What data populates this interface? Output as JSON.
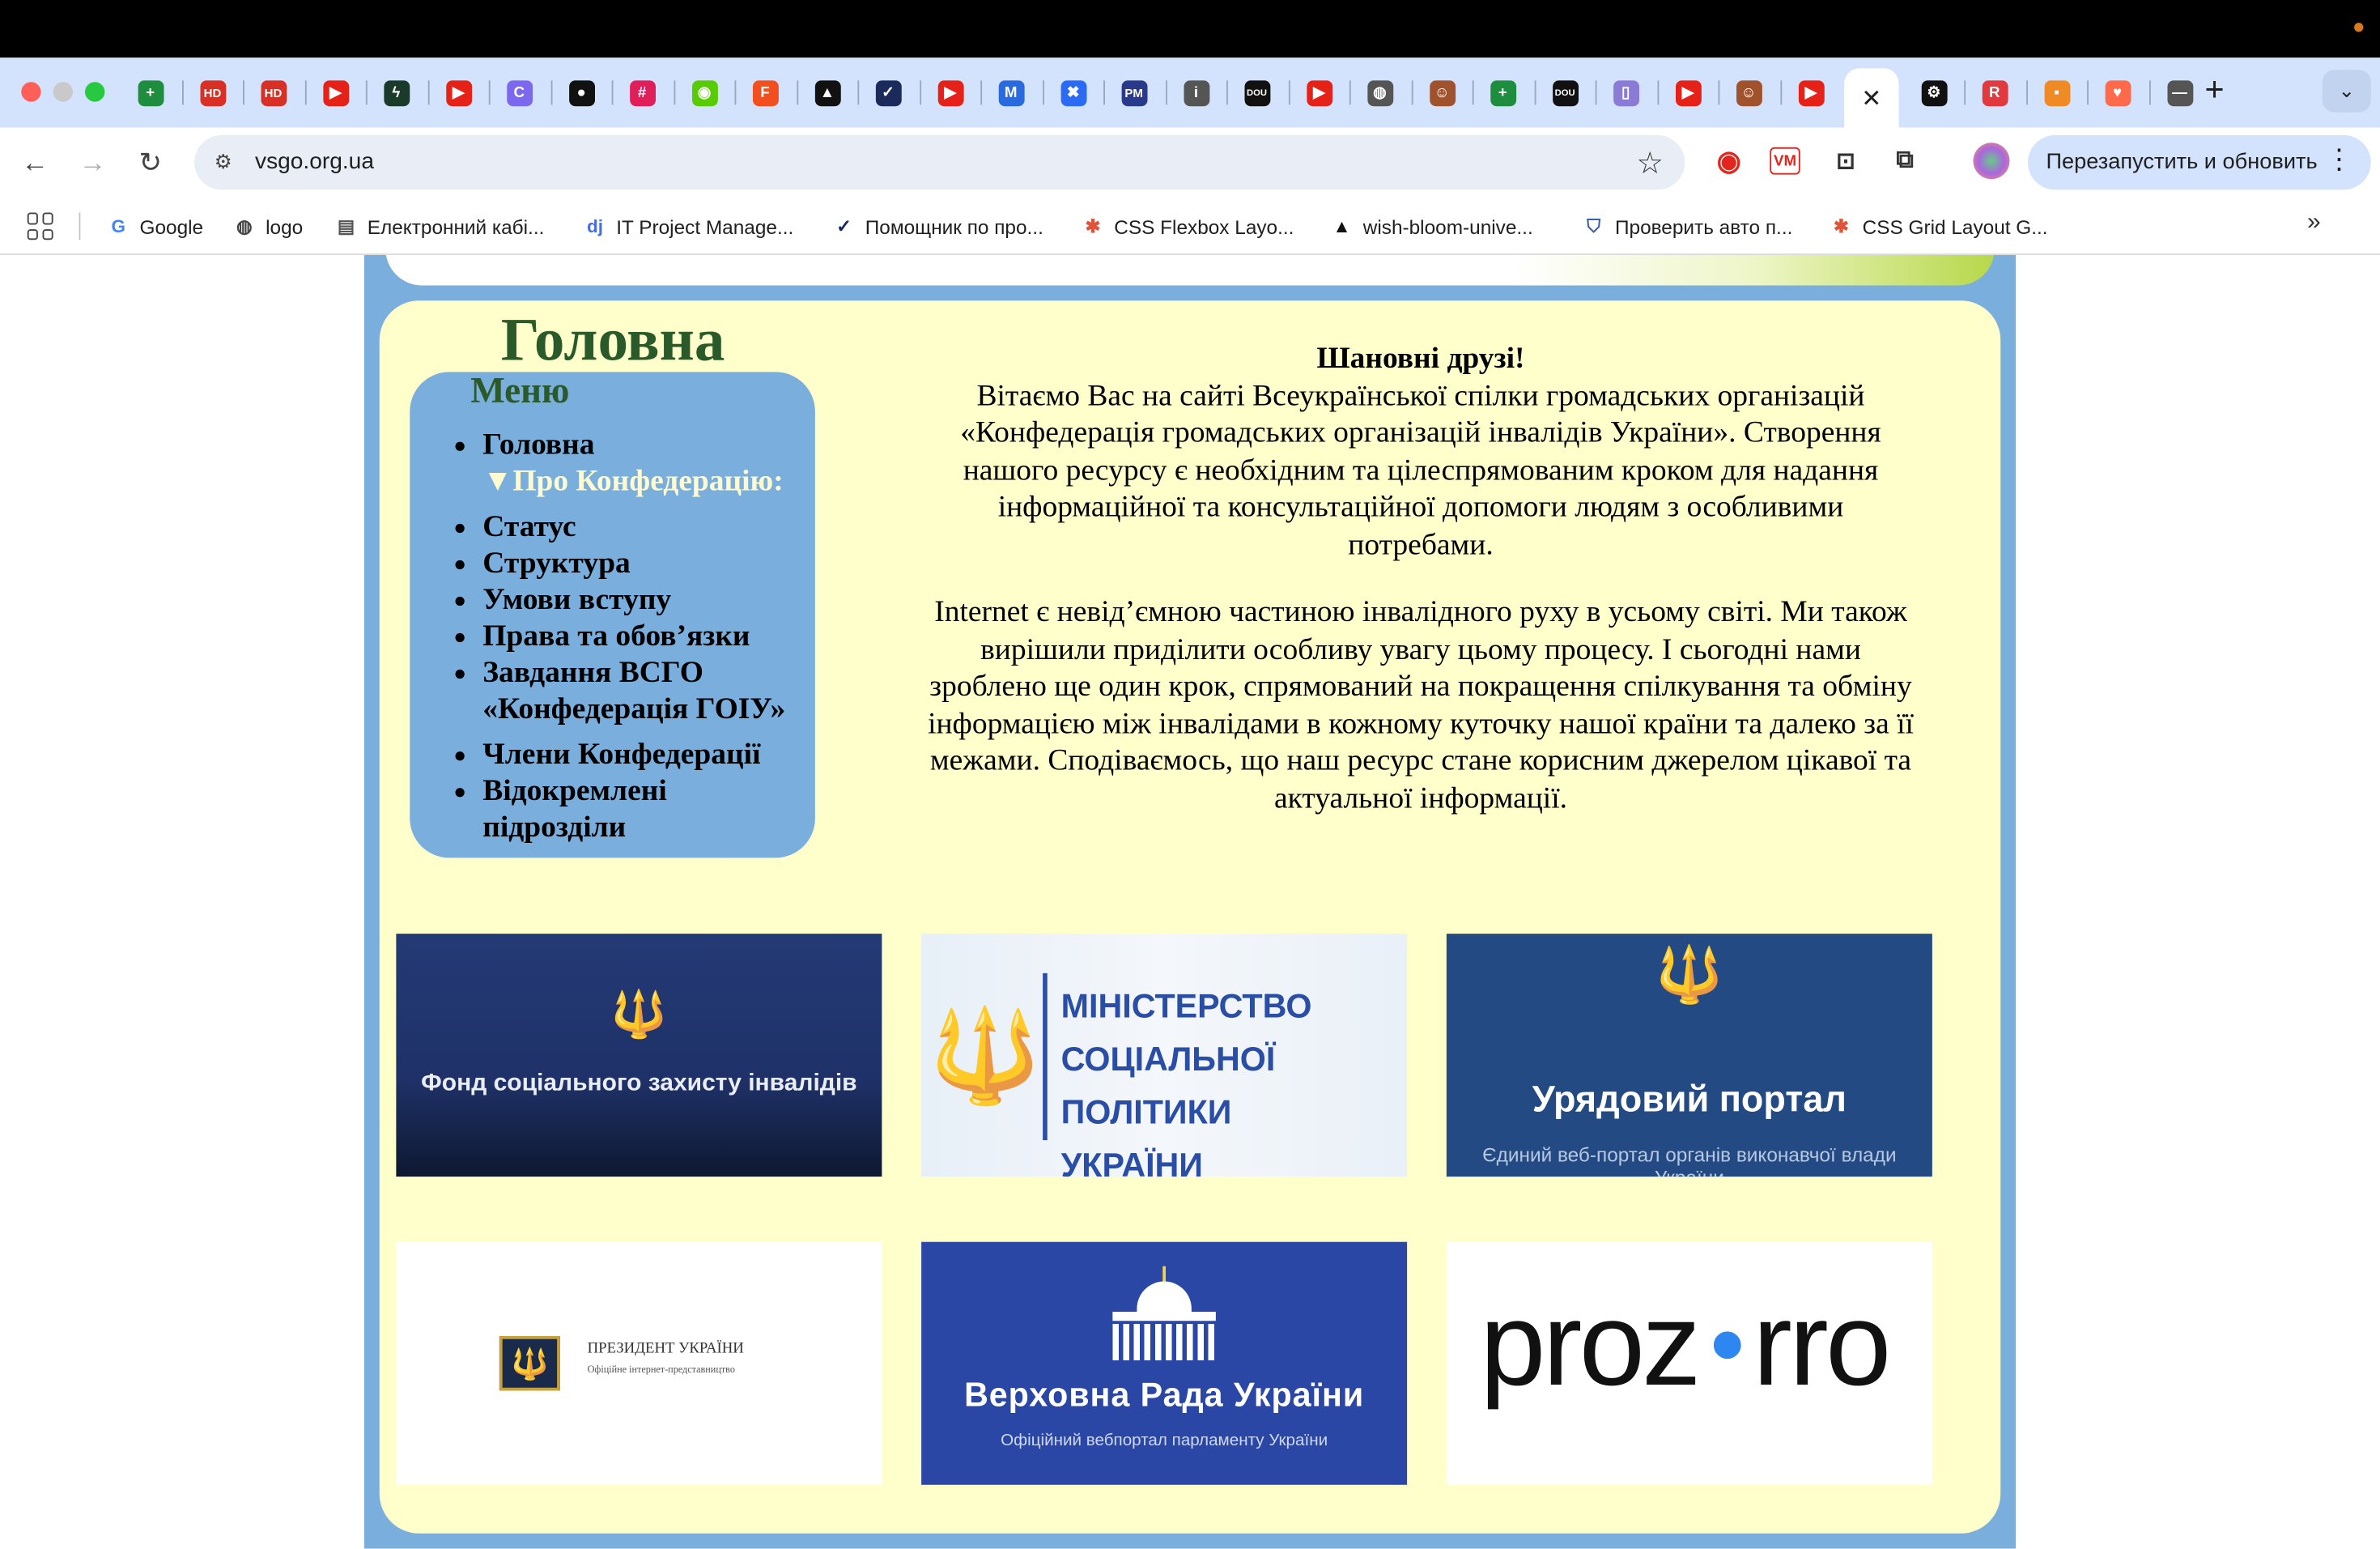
{
  "browser": {
    "tabs": [
      {
        "icon": "plus-green",
        "color": "#1e8e3e",
        "glyph": "+"
      },
      {
        "icon": "hd-red",
        "color": "#d93025",
        "glyph": "HD"
      },
      {
        "icon": "hd-red",
        "color": "#d93025",
        "glyph": "HD"
      },
      {
        "icon": "youtube",
        "color": "#e62117",
        "glyph": "▶"
      },
      {
        "icon": "bolt",
        "color": "#1b3b2a",
        "glyph": "ϟ"
      },
      {
        "icon": "youtube",
        "color": "#e62117",
        "glyph": "▶"
      },
      {
        "icon": "clickup",
        "color": "#7b68ee",
        "glyph": "C"
      },
      {
        "icon": "github",
        "color": "#111111",
        "glyph": "●"
      },
      {
        "icon": "slack",
        "color": "#e01e5a",
        "glyph": "#"
      },
      {
        "icon": "duolingo",
        "color": "#58cc02",
        "glyph": "◉"
      },
      {
        "icon": "figma",
        "color": "#f24e1e",
        "glyph": "F"
      },
      {
        "icon": "triangle",
        "color": "#111111",
        "glyph": "▲"
      },
      {
        "icon": "check",
        "color": "#1a2a5a",
        "glyph": "✓"
      },
      {
        "icon": "youtube",
        "color": "#e62117",
        "glyph": "▶"
      },
      {
        "icon": "mj",
        "color": "#2a6adf",
        "glyph": "M"
      },
      {
        "icon": "xmind",
        "color": "#2b6af2",
        "glyph": "✖"
      },
      {
        "icon": "pm",
        "color": "#2a3a8a",
        "glyph": "PM"
      },
      {
        "icon": "info",
        "color": "#555555",
        "glyph": "i"
      },
      {
        "icon": "dou",
        "color": "#111111",
        "glyph": "DOU"
      },
      {
        "icon": "youtube",
        "color": "#e62117",
        "glyph": "▶"
      },
      {
        "icon": "globe",
        "color": "#555555",
        "glyph": "◍"
      },
      {
        "icon": "face",
        "color": "#a0522d",
        "glyph": "☺"
      },
      {
        "icon": "plus-green",
        "color": "#1e8e3e",
        "glyph": "+"
      },
      {
        "icon": "dou",
        "color": "#111111",
        "glyph": "DOU"
      },
      {
        "icon": "doc",
        "color": "#8a7bd6",
        "glyph": "▯"
      },
      {
        "icon": "youtube",
        "color": "#e62117",
        "glyph": "▶"
      },
      {
        "icon": "face",
        "color": "#a0522d",
        "glyph": "☺"
      },
      {
        "icon": "youtube",
        "color": "#e62117",
        "glyph": "▶"
      },
      {
        "icon": "close",
        "color": "#1f1f1f",
        "glyph": "✕",
        "active": true
      },
      {
        "icon": "openai",
        "color": "#111111",
        "glyph": "⚙"
      },
      {
        "icon": "r-red",
        "color": "#e0393e",
        "glyph": "R"
      },
      {
        "icon": "orange",
        "color": "#f08a24",
        "glyph": "▪"
      },
      {
        "icon": "heart",
        "color": "#ff6b4a",
        "glyph": "♥"
      },
      {
        "icon": "line",
        "color": "#555555",
        "glyph": "—"
      }
    ],
    "url": "vsgo.org.ua",
    "relaunch_label": "Перезапустить и обновить",
    "bookmarks": [
      {
        "label": "Google",
        "icon": "google-icon",
        "glyph": "G",
        "color": "#4285f4"
      },
      {
        "label": "logo",
        "icon": "globe-icon",
        "glyph": "◍",
        "color": "#444444"
      },
      {
        "label": "Електронний кабі...",
        "icon": "doc-icon",
        "glyph": "▤",
        "color": "#555555"
      },
      {
        "label": "IT Project Manage...",
        "icon": "dj-icon",
        "glyph": "dj",
        "color": "#4a6ee0"
      },
      {
        "label": "Помощник по про...",
        "icon": "check-icon",
        "glyph": "✓",
        "color": "#1a2a5a"
      },
      {
        "label": "CSS Flexbox Layo...",
        "icon": "asterisk-icon",
        "glyph": "✱",
        "color": "#e0533a"
      },
      {
        "label": "wish-bloom-unive...",
        "icon": "triangle-icon",
        "glyph": "▲",
        "color": "#111111"
      },
      {
        "label": "Проверить авто п...",
        "icon": "shield-icon",
        "glyph": "⛉",
        "color": "#3a5fb0"
      },
      {
        "label": "CSS Grid Layout G...",
        "icon": "asterisk-icon",
        "glyph": "✱",
        "color": "#e0533a"
      }
    ]
  },
  "page": {
    "heading": "Головна",
    "menu": {
      "title": "Меню",
      "items": [
        "Головна",
        "▼Про Конфедерацію:",
        "Статус",
        "Структура",
        "Умови вступу",
        "Права та обов’язки",
        "Завдання ВСГО «Конфедерація ГОІУ»",
        "Члени Конфедерації",
        "Відокремлені підрозділи"
      ]
    },
    "welcome": {
      "greeting": "Шановні друзі!",
      "para1": "Вітаємо Вас на сайті Всеукраїнської спілки громадських організацій «Конфедерація громадських організацій інвалідів України». Створення нашого ресурсу є необхідним та цілеспрямованим кроком для надання інформаційної та консультаційної допомоги людям з особливими потребами.",
      "para2": "Internet є невід’ємною частиною інвалідного руху в усьому світі. Ми також вирішили приділити особливу увагу цьому процесу. І сьогодні нами зроблено ще один крок, спрямований на покращення спілкування та обміну інформацією між інвалідами в кожному куточку нашої країни та далеко за її межами. Сподіваємось, що наш ресурс стане корисним джерелом цікавої та актуальної інформації."
    },
    "banners": {
      "b1": {
        "title": "Фонд соціального захисту інвалідів"
      },
      "b2": {
        "line1": "МІНІСТЕРСТВО",
        "line2": "СОЦІАЛЬНОЇ ПОЛІТИКИ",
        "line3": "УКРАЇНИ"
      },
      "b3": {
        "title": "Урядовий портал",
        "subtitle": "Єдиний веб-портал органів виконавчої влади України"
      },
      "b4": {
        "title": "ПРЕЗИДЕНТ УКРАЇНИ",
        "subtitle": "Офіційне інтернет-представництво"
      },
      "b5": {
        "title": "Верховна Рада України",
        "subtitle": "Офіційний вебпортал парламенту України"
      },
      "b6": {
        "left": "proz",
        "right": "rro"
      }
    }
  }
}
